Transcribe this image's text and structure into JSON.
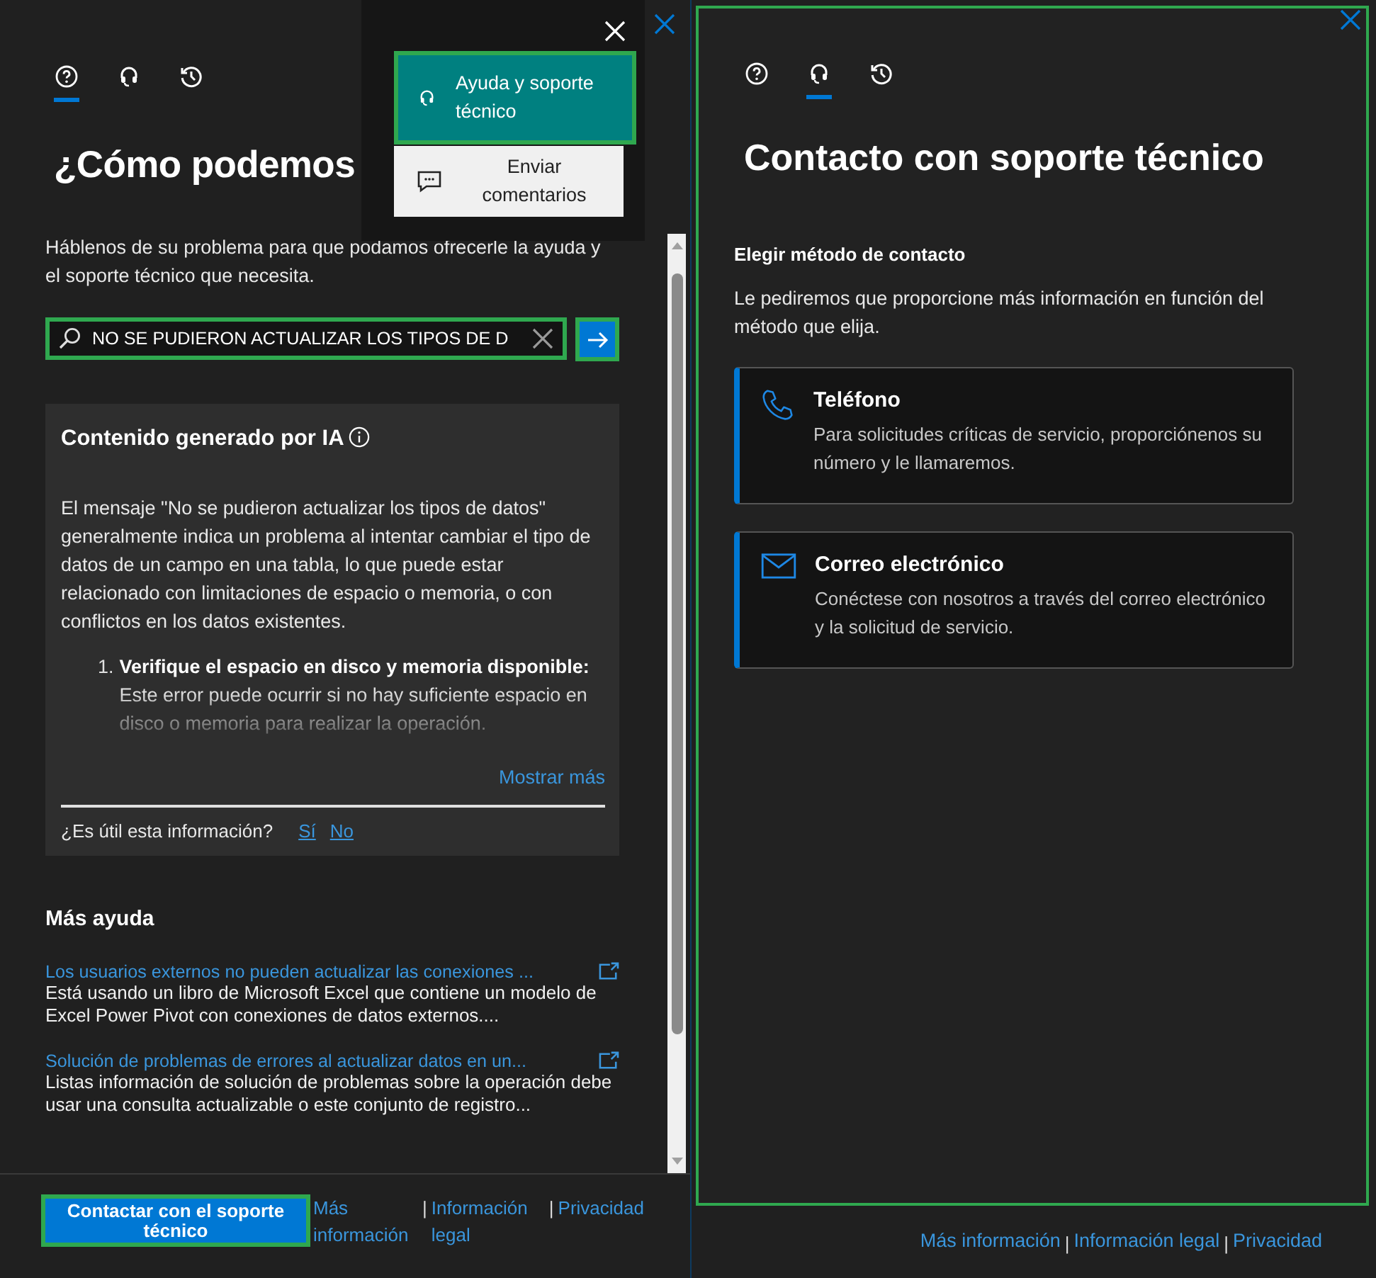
{
  "left_panel": {
    "tabs": [
      {
        "kind": "help",
        "selected": true
      },
      {
        "kind": "headset",
        "selected": false
      },
      {
        "kind": "history",
        "selected": false
      }
    ],
    "title": "¿Cómo podemos",
    "intro": "Háblenos de su problema para que podamos ofrecerle la ayuda y el soporte técnico que necesita.",
    "search": {
      "value": "NO SE PUDIERON ACTUALIZAR LOS TIPOS DE D"
    },
    "ai_card": {
      "title": "Contenido generado por IA",
      "paragraph": "El mensaje \"No se pudieron actualizar los tipos de datos\" generalmente indica un problema al intentar cambiar el tipo de datos de un campo en una tabla, lo que puede estar relacionado con limitaciones de espacio o memoria, o con conflictos en los datos existentes.",
      "steps": [
        {
          "number": "1.",
          "text": "**Verifique el espacio en disco y memoria disponible:** Este error puede ocurrir si no hay suficiente espacio en disco o memoria para realizar la operación."
        }
      ],
      "show_more": "Mostrar más",
      "feedback": {
        "question": "¿Es útil esta información?",
        "yes": "Sí",
        "no": "No"
      }
    },
    "more_help": {
      "heading": "Más ayuda",
      "articles": [
        {
          "title": "Los usuarios externos no pueden actualizar las conexiones ...",
          "summary": "Está usando un libro de Microsoft Excel que contiene un modelo de Excel Power Pivot con conexiones de datos externos...."
        },
        {
          "title": "Solución de problemas de errores al actualizar datos en un...",
          "summary": "Listas información de solución de problemas sobre la operación debe usar una consulta actualizable o este conjunto de registro..."
        }
      ]
    },
    "footer": {
      "contact_button": "Contactar con el soporte técnico",
      "separator": "|",
      "links": [
        "Más información",
        "Información legal",
        "Privacidad"
      ]
    }
  },
  "menu": {
    "items": [
      {
        "kind": "headset",
        "label": "Ayuda y soporte técnico",
        "selected": true
      },
      {
        "kind": "feedback",
        "label": "Enviar comentarios",
        "selected": false
      }
    ]
  },
  "right_panel": {
    "tabs": [
      {
        "kind": "help",
        "selected": false
      },
      {
        "kind": "headset",
        "selected": true
      },
      {
        "kind": "history",
        "selected": false
      }
    ],
    "title": "Contacto con soporte técnico",
    "section_heading": "Elegir método de contacto",
    "description": "Le pediremos que proporcione más información en función del método que elija.",
    "methods": [
      {
        "kind": "phone",
        "title": "Teléfono",
        "description": "Para solicitudes críticas de servicio, proporciónenos su número y le llamaremos."
      },
      {
        "kind": "email",
        "title": "Correo electrónico",
        "description": "Conéctese con nosotros a través del correo electrónico y la solicitud de servicio."
      }
    ],
    "footer": {
      "separator": "|",
      "links": [
        "Más información",
        "Información legal",
        "Privacidad"
      ]
    }
  }
}
